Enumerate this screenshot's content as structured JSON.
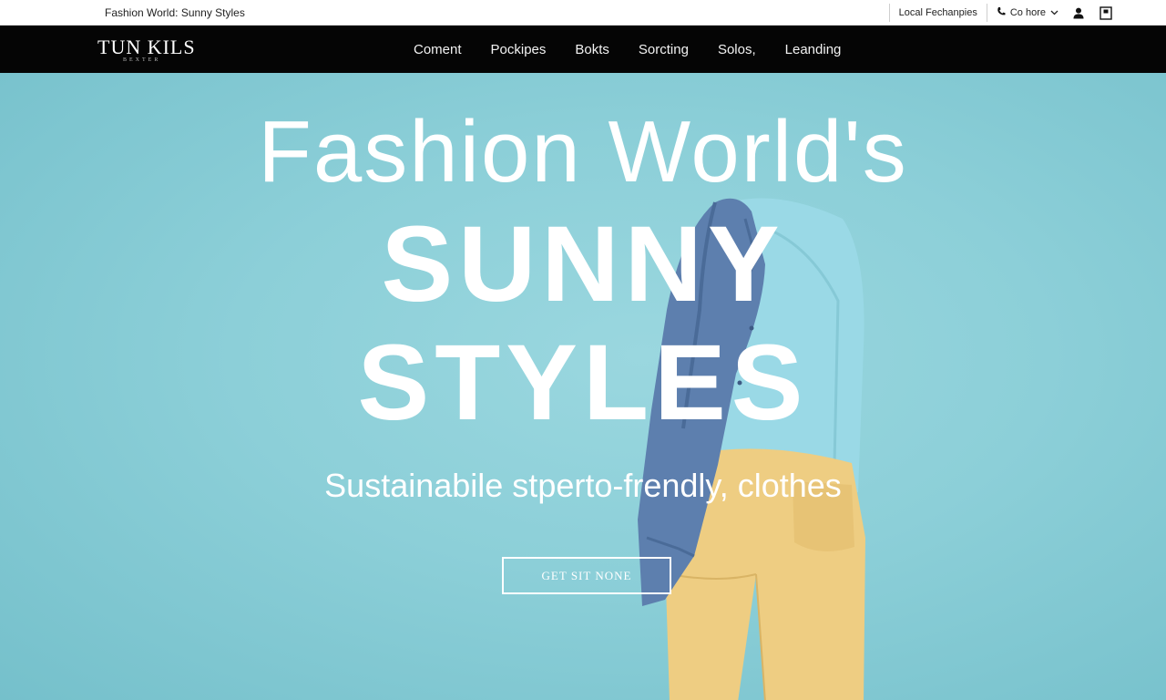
{
  "topbar": {
    "tagline": "Fashion World: Sunny Styles",
    "local_link": "Local Fechanpies",
    "contact_link": "Co hore",
    "icons": [
      "phone-icon",
      "chevron-down-icon",
      "user-icon",
      "bag-icon"
    ]
  },
  "brand": {
    "logo_text": "TUN KILS",
    "logo_subtext": "BEXTER"
  },
  "nav": {
    "items": [
      "Coment",
      "Pockipes",
      "Bokts",
      "Sorcting",
      "Solos,",
      "Leanding"
    ]
  },
  "hero": {
    "title_line1": "Fashion World's",
    "title_line2": "SUNNY",
    "title_line3": "STYLES",
    "subtitle": "Sustainabile stperto-frendly, clothes",
    "cta_label": "GET SIT NONE"
  },
  "colors": {
    "nav_bg": "#050505",
    "hero_bg": "#8fd0d9",
    "jacket": "#5d7fae",
    "shirt": "#9ad9e6",
    "pants": "#eecd82"
  }
}
